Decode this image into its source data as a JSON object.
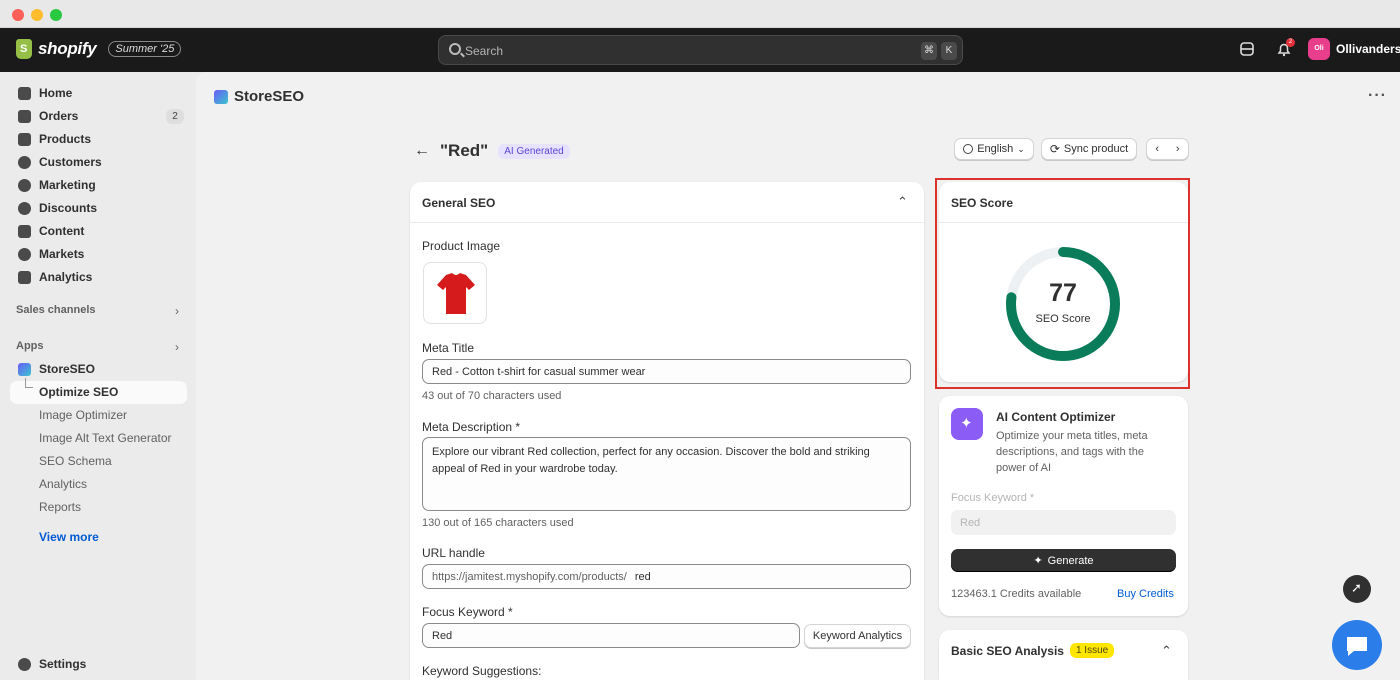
{
  "topbar": {
    "brand": "shopify",
    "edition": "Summer '25",
    "search_placeholder": "Search",
    "shortcut_keys": [
      "⌘",
      "K"
    ],
    "notification_count": "2",
    "user_initials": "Oli",
    "user_name": "Ollivanders"
  },
  "sidebar": {
    "items": [
      {
        "label": "Home",
        "icon": "home-icon"
      },
      {
        "label": "Orders",
        "icon": "orders-icon",
        "count": "2"
      },
      {
        "label": "Products",
        "icon": "tag-icon"
      },
      {
        "label": "Customers",
        "icon": "person-icon"
      },
      {
        "label": "Marketing",
        "icon": "target-icon"
      },
      {
        "label": "Discounts",
        "icon": "discount-icon"
      },
      {
        "label": "Content",
        "icon": "content-icon"
      },
      {
        "label": "Markets",
        "icon": "globe-icon"
      },
      {
        "label": "Analytics",
        "icon": "bar-chart-icon"
      }
    ],
    "sales_channels": "Sales channels",
    "apps": "Apps",
    "app_name": "StoreSEO",
    "app_subitems": [
      "Optimize SEO",
      "Image Optimizer",
      "Image Alt Text Generator",
      "SEO Schema",
      "Analytics",
      "Reports"
    ],
    "view_more": "View more",
    "settings": "Settings"
  },
  "app": {
    "title": "StoreSEO"
  },
  "page": {
    "title": "\"Red\"",
    "badge": "AI Generated",
    "language": "English",
    "sync": "Sync product"
  },
  "general_seo": {
    "heading": "General SEO",
    "product_image_label": "Product Image",
    "meta_title_label": "Meta Title",
    "meta_title_value": "Red - Cotton t-shirt for casual summer wear",
    "meta_title_help": "43 out of 70 characters used",
    "meta_desc_label": "Meta Description *",
    "meta_desc_value": "Explore our vibrant Red collection, perfect for any occasion. Discover the bold and striking appeal of Red in your wardrobe today.",
    "meta_desc_help": "130 out of 165 characters used",
    "url_label": "URL handle",
    "url_prefix": "https://jamitest.myshopify.com/products/",
    "url_value": "red",
    "focus_label": "Focus Keyword *",
    "focus_value": "Red",
    "keyword_btn": "Keyword Analytics",
    "suggestions_label": "Keyword Suggestions:"
  },
  "seo_score": {
    "heading": "SEO Score",
    "value": 77,
    "label": "SEO Score",
    "ring_color": "#0a7c59",
    "track_color": "#eef1f3"
  },
  "ai_optimizer": {
    "title": "AI Content Optimizer",
    "description": "Optimize your meta titles, meta descriptions, and tags with the power of AI",
    "focus_label": "Focus Keyword *",
    "focus_value": "Red",
    "generate": "Generate",
    "credits": "123463.1 Credits available",
    "buy": "Buy Credits"
  },
  "basic_analysis": {
    "heading": "Basic SEO Analysis",
    "issue": "1 Issue"
  }
}
